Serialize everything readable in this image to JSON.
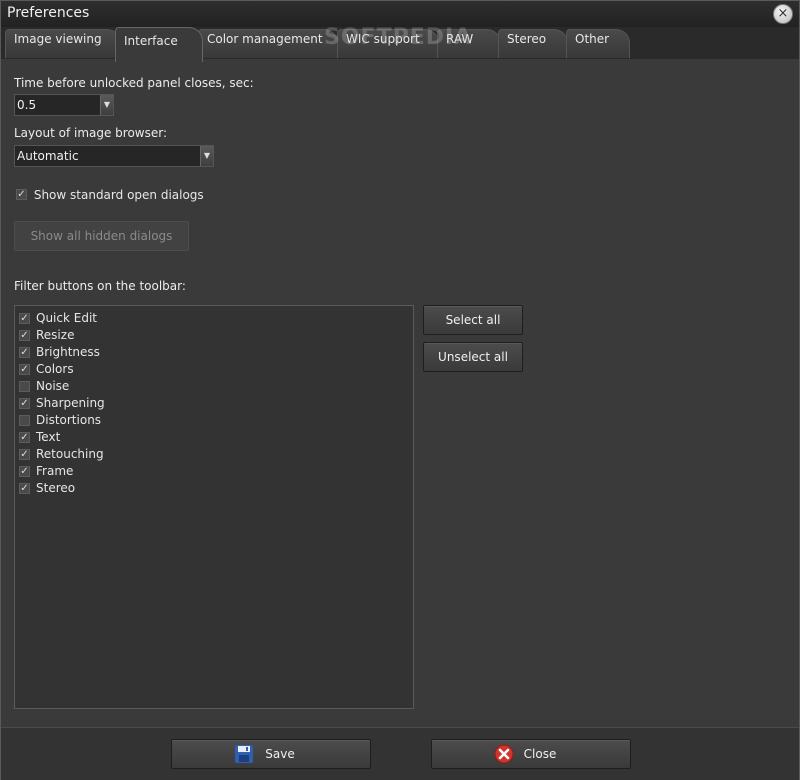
{
  "window": {
    "title": "Preferences",
    "close_icon": "×"
  },
  "tabs": [
    {
      "label": "Image viewing",
      "active": false
    },
    {
      "label": "Interface",
      "active": true
    },
    {
      "label": "Color management",
      "active": false
    },
    {
      "label": "WIC support",
      "active": false
    },
    {
      "label": "RAW",
      "active": false
    },
    {
      "label": "Stereo",
      "active": false
    },
    {
      "label": "Other",
      "active": false
    }
  ],
  "watermark": "SOFTPEDIA",
  "interface": {
    "panel_close_label": "Time before unlocked panel closes, sec:",
    "panel_close_value": "0.5",
    "layout_label": "Layout of image browser:",
    "layout_value": "Automatic",
    "show_dialogs_label": "Show standard open dialogs",
    "show_dialogs_checked": true,
    "show_hidden_button": "Show all hidden dialogs",
    "filter_label": "Filter buttons on the toolbar:",
    "filters": [
      {
        "label": "Quick Edit",
        "checked": true
      },
      {
        "label": "Resize",
        "checked": true
      },
      {
        "label": "Brightness",
        "checked": true
      },
      {
        "label": "Colors",
        "checked": true
      },
      {
        "label": "Noise",
        "checked": false
      },
      {
        "label": "Sharpening",
        "checked": true
      },
      {
        "label": "Distortions",
        "checked": false
      },
      {
        "label": "Text",
        "checked": true
      },
      {
        "label": "Retouching",
        "checked": true
      },
      {
        "label": "Frame",
        "checked": true
      },
      {
        "label": "Stereo",
        "checked": true
      }
    ],
    "select_all": "Select all",
    "unselect_all": "Unselect all"
  },
  "footer": {
    "save": "Save",
    "close": "Close"
  },
  "colors": {
    "background": "#3a3a3a",
    "save_icon": "#2f5fb0",
    "close_icon": "#d0342c"
  }
}
